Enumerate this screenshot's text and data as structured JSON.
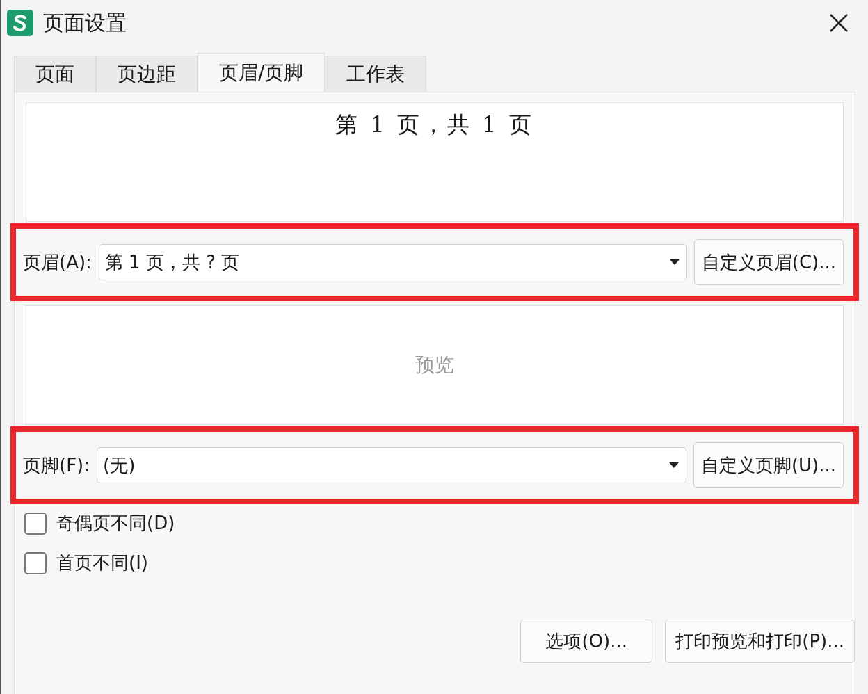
{
  "window": {
    "title": "页面设置"
  },
  "tabs": [
    {
      "label": "页面",
      "selected": false
    },
    {
      "label": "页边距",
      "selected": false
    },
    {
      "label": "页眉/页脚",
      "selected": true
    },
    {
      "label": "工作表",
      "selected": false
    }
  ],
  "header_preview": {
    "text": "第 1 页，共 1 页"
  },
  "header": {
    "label": "页眉(A):",
    "value": "第 1 页，共 ? 页",
    "button": "自定义页眉(C)..."
  },
  "footer_preview": {
    "label": "预览"
  },
  "footer": {
    "label": "页脚(F):",
    "value": "(无)",
    "button": "自定义页脚(U)..."
  },
  "options": [
    {
      "label": "奇偶页不同(D)",
      "checked": false
    },
    {
      "label": "首页不同(I)",
      "checked": false
    }
  ],
  "buttons": [
    "选项(O)...",
    "打印预览和打印(P)..."
  ]
}
